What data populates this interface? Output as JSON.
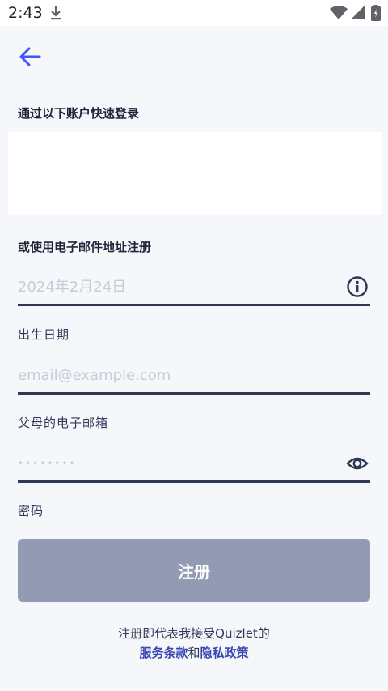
{
  "status_bar": {
    "time": "2:43"
  },
  "header": {
    "back_icon": "arrow-left-icon"
  },
  "social": {
    "heading": "通过以下账户快速登录"
  },
  "email_signup": {
    "heading": "或使用电子邮件地址注册"
  },
  "form": {
    "birthday": {
      "placeholder": "2024年2月24日",
      "label": "出生日期",
      "icon": "info-icon"
    },
    "parent_email": {
      "placeholder": "email@example.com",
      "label": "父母的电子邮箱"
    },
    "password": {
      "placeholder": "••••••••",
      "label": "密码",
      "icon": "eye-icon"
    }
  },
  "actions": {
    "signup_label": "注册"
  },
  "terms": {
    "prefix": "注册即代表我接受Quizlet的",
    "terms_link": "服务条款",
    "conjunction": "和",
    "privacy_link": "隐私政策"
  },
  "colors": {
    "accent": "#4255ff",
    "text": "#2e3856",
    "button_disabled": "#939bb4",
    "background": "#f6f7fb"
  }
}
